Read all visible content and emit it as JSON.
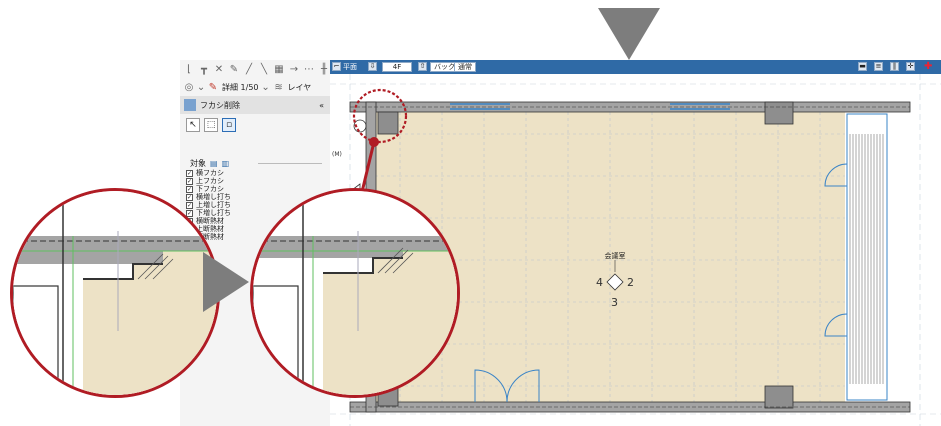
{
  "toolbar": {
    "scale_label": "詳細 1/50",
    "layer_label": "レイヤ"
  },
  "command_panel": {
    "title": "フカシ削除",
    "target_label": "対象",
    "checkboxes": [
      {
        "label": "横フカシ",
        "checked": true
      },
      {
        "label": "上フカシ",
        "checked": true
      },
      {
        "label": "下フカシ",
        "checked": true
      },
      {
        "label": "横増し打ち",
        "checked": true
      },
      {
        "label": "上増し打ち",
        "checked": true
      },
      {
        "label": "下増し打ち",
        "checked": true
      },
      {
        "label": "横断熱材",
        "checked": true
      },
      {
        "label": "上断熱材",
        "checked": true
      },
      {
        "label": "下断熱材",
        "checked": true
      }
    ]
  },
  "view_bar": {
    "view_label": "平面",
    "floor": "4F",
    "back_label": "バック",
    "mode_label": "通常"
  },
  "drawing": {
    "room_name": "会議室",
    "compass": {
      "left": "4",
      "right": "2",
      "bottom": "3"
    },
    "left_mark": "(M)"
  },
  "colors": {
    "accent_blue": "#2f6aa6",
    "highlight_red": "#b01c24",
    "floor_fill": "#ede2c6",
    "wall_gray": "#a4a4a4",
    "arrow_gray": "#7d7d7d"
  }
}
